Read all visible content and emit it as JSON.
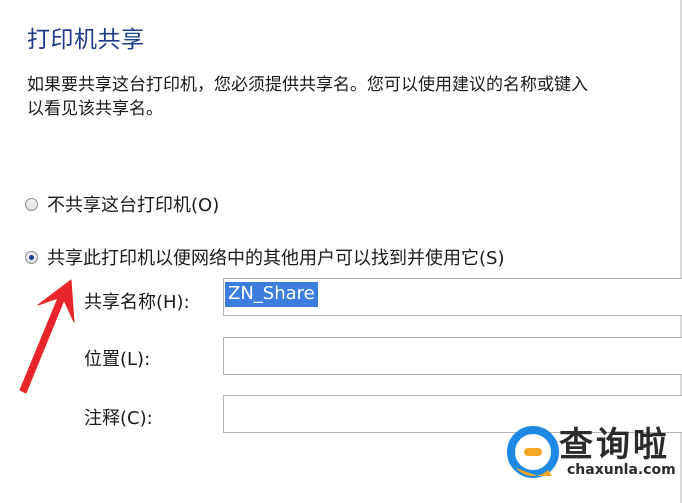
{
  "dialog": {
    "title": "打印机共享",
    "description_line1": "如果要共享这台打印机，您必须提供共享名。您可以使用建议的名称或键入",
    "description_line2": "以看见该共享名。"
  },
  "options": {
    "no_share_label": "不共享这台打印机(O)",
    "no_share_selected": false,
    "share_label": "共享此打印机以便网络中的其他用户可以找到并使用它(S)",
    "share_selected": true
  },
  "fields": {
    "share_name_label": "共享名称(H):",
    "share_name_value": "ZN_Share",
    "location_label": "位置(L):",
    "location_value": "",
    "comment_label": "注释(C):",
    "comment_value": ""
  },
  "annotation": {
    "arrow_color": "#e8252a"
  },
  "watermark": {
    "brand_text": "查询啦",
    "brand_url": "chaxunla.com",
    "logo_color_blue": "#1e88e5",
    "logo_color_orange": "#f5a623"
  }
}
